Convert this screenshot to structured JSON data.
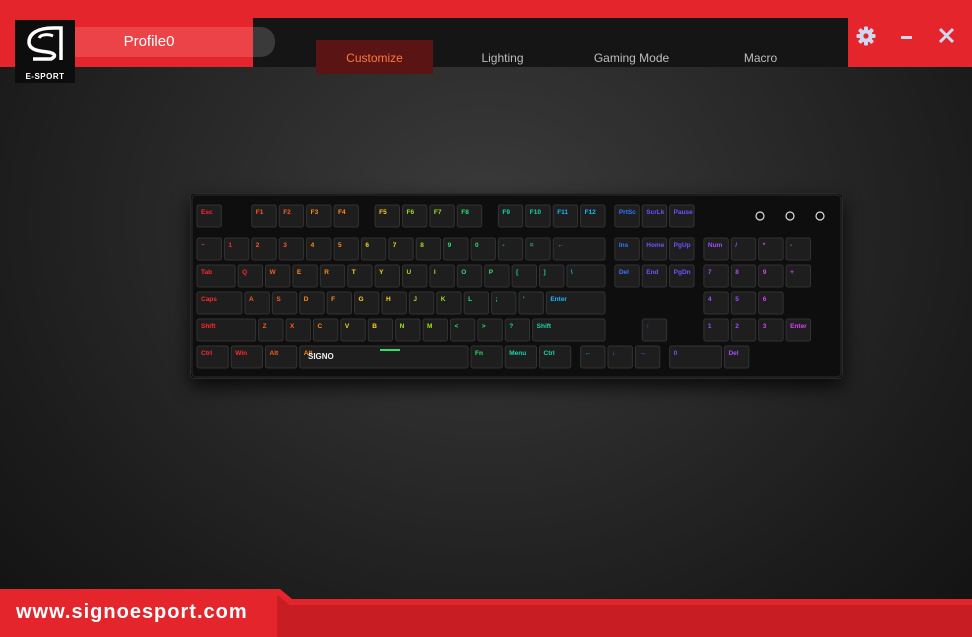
{
  "app": {
    "profile_name": "Profile0",
    "logo_text": "E-SPORT",
    "brand_on_keyboard": "SIGNO",
    "website": "www.signoesport.com",
    "accent_color": "#e4262c"
  },
  "tabs": [
    {
      "label": "Customize",
      "active": true
    },
    {
      "label": "Lighting",
      "active": false
    },
    {
      "label": "Gaming Mode",
      "active": false
    },
    {
      "label": "Macro",
      "active": false
    }
  ],
  "window_controls": [
    "gear-icon",
    "minimize-icon",
    "close-icon"
  ],
  "keyboard": {
    "rows": [
      [
        "Esc",
        "F1",
        "F2",
        "F3",
        "F4",
        "F5",
        "F6",
        "F7",
        "F8",
        "F9",
        "F10",
        "F11",
        "F12",
        "PrtSc",
        "ScrLk",
        "Pause"
      ],
      [
        "~",
        "1",
        "2",
        "3",
        "4",
        "5",
        "6",
        "7",
        "8",
        "9",
        "0",
        "-",
        "=",
        "←",
        "Ins",
        "Home",
        "PgUp",
        "Num",
        "/",
        "*",
        "-"
      ],
      [
        "Tab",
        "Q",
        "W",
        "E",
        "R",
        "T",
        "Y",
        "U",
        "I",
        "O",
        "P",
        "[",
        "]",
        "\\",
        "Del",
        "End",
        "PgDn",
        "7",
        "8",
        "9",
        "+"
      ],
      [
        "Caps",
        "A",
        "S",
        "D",
        "F",
        "G",
        "H",
        "J",
        "K",
        "L",
        ";",
        "'",
        "Enter",
        "4",
        "5",
        "6"
      ],
      [
        "Shift",
        "Z",
        "X",
        "C",
        "V",
        "B",
        "N",
        "M",
        "<",
        ">",
        "?",
        "Shift",
        "↑",
        "1",
        "2",
        "3",
        "Enter"
      ],
      [
        "Ctrl",
        "Win",
        "Alt",
        "Alt",
        "Fn",
        "Menu",
        "Ctrl",
        "←",
        "↓",
        "→",
        "0",
        "Del"
      ]
    ]
  }
}
